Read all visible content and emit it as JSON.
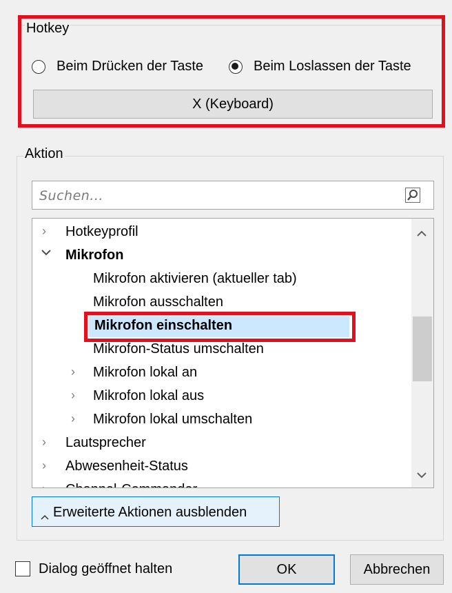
{
  "hotkey": {
    "group_title": "Hotkey",
    "radio_press_label": "Beim Drücken der Taste",
    "radio_release_label": "Beim Loslassen der Taste",
    "selected": "release",
    "key_button_label": "X (Keyboard)"
  },
  "action": {
    "group_title": "Aktion",
    "search_placeholder": "Suchen...",
    "tree": {
      "hotkeyprofil": "Hotkeyprofil",
      "mikrofon": "Mikrofon",
      "mic_activate": "Mikrofon aktivieren (aktueller tab)",
      "mic_off": "Mikrofon ausschalten",
      "mic_on": "Mikrofon einschalten",
      "mic_toggle": "Mikrofon-Status umschalten",
      "mic_local_on": "Mikrofon lokal an",
      "mic_local_off": "Mikrofon lokal aus",
      "mic_local_toggle": "Mikrofon lokal umschalten",
      "speaker": "Lautsprecher",
      "away": "Abwesenheit-Status",
      "partial": "Channel-Commander"
    },
    "advanced_button_label": "Erweiterte Aktionen ausblenden"
  },
  "footer": {
    "keep_open_label": "Dialog geöffnet halten",
    "ok_label": "OK",
    "cancel_label": "Abbrechen"
  },
  "colors": {
    "highlight_red": "#e0101e",
    "selection_blue": "#cce8ff",
    "focus_blue": "#0078d7"
  }
}
